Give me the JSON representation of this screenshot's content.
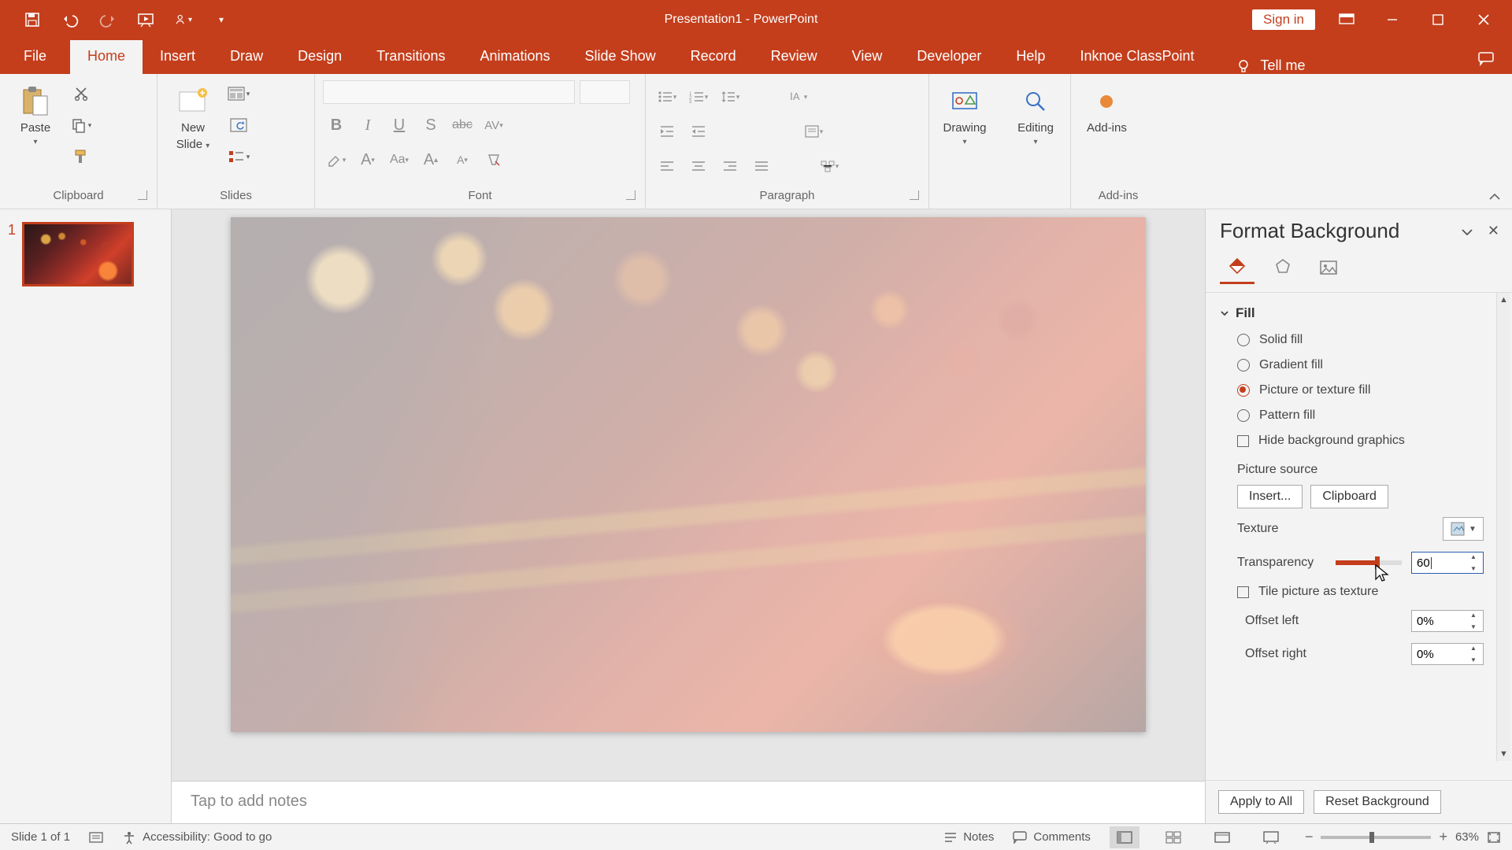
{
  "title": "Presentation1  -  PowerPoint",
  "signin": "Sign in",
  "tabs": {
    "file": "File",
    "home": "Home",
    "insert": "Insert",
    "draw": "Draw",
    "design": "Design",
    "transitions": "Transitions",
    "animations": "Animations",
    "slideshow": "Slide Show",
    "record": "Record",
    "review": "Review",
    "view": "View",
    "developer": "Developer",
    "help": "Help",
    "inknoe": "Inknoe ClassPoint",
    "tellme": "Tell me"
  },
  "groups": {
    "clipboard": "Clipboard",
    "slides": "Slides",
    "font": "Font",
    "paragraph": "Paragraph",
    "addins": "Add-ins"
  },
  "ribbon": {
    "paste": "Paste",
    "newslide1": "New",
    "newslide2": "Slide",
    "drawing": "Drawing",
    "editing": "Editing",
    "addins": "Add-ins"
  },
  "thumb_num": "1",
  "notes_placeholder": "Tap to add notes",
  "pane": {
    "title": "Format Background",
    "section_fill": "Fill",
    "solid": "Solid fill",
    "gradient": "Gradient fill",
    "picture": "Picture or texture fill",
    "pattern": "Pattern fill",
    "hidebg": "Hide background graphics",
    "picsource": "Picture source",
    "insert": "Insert...",
    "clipboard": "Clipboard",
    "texture": "Texture",
    "transparency": "Transparency",
    "transparency_val": "60",
    "tile": "Tile picture as texture",
    "offset_left": "Offset left",
    "offset_left_val": "0%",
    "offset_right": "Offset right",
    "offset_right_val": "0%",
    "apply": "Apply to All",
    "reset": "Reset Background"
  },
  "status": {
    "slide": "Slide 1 of 1",
    "a11y": "Accessibility: Good to go",
    "notes": "Notes",
    "comments": "Comments",
    "zoom": "63%"
  }
}
